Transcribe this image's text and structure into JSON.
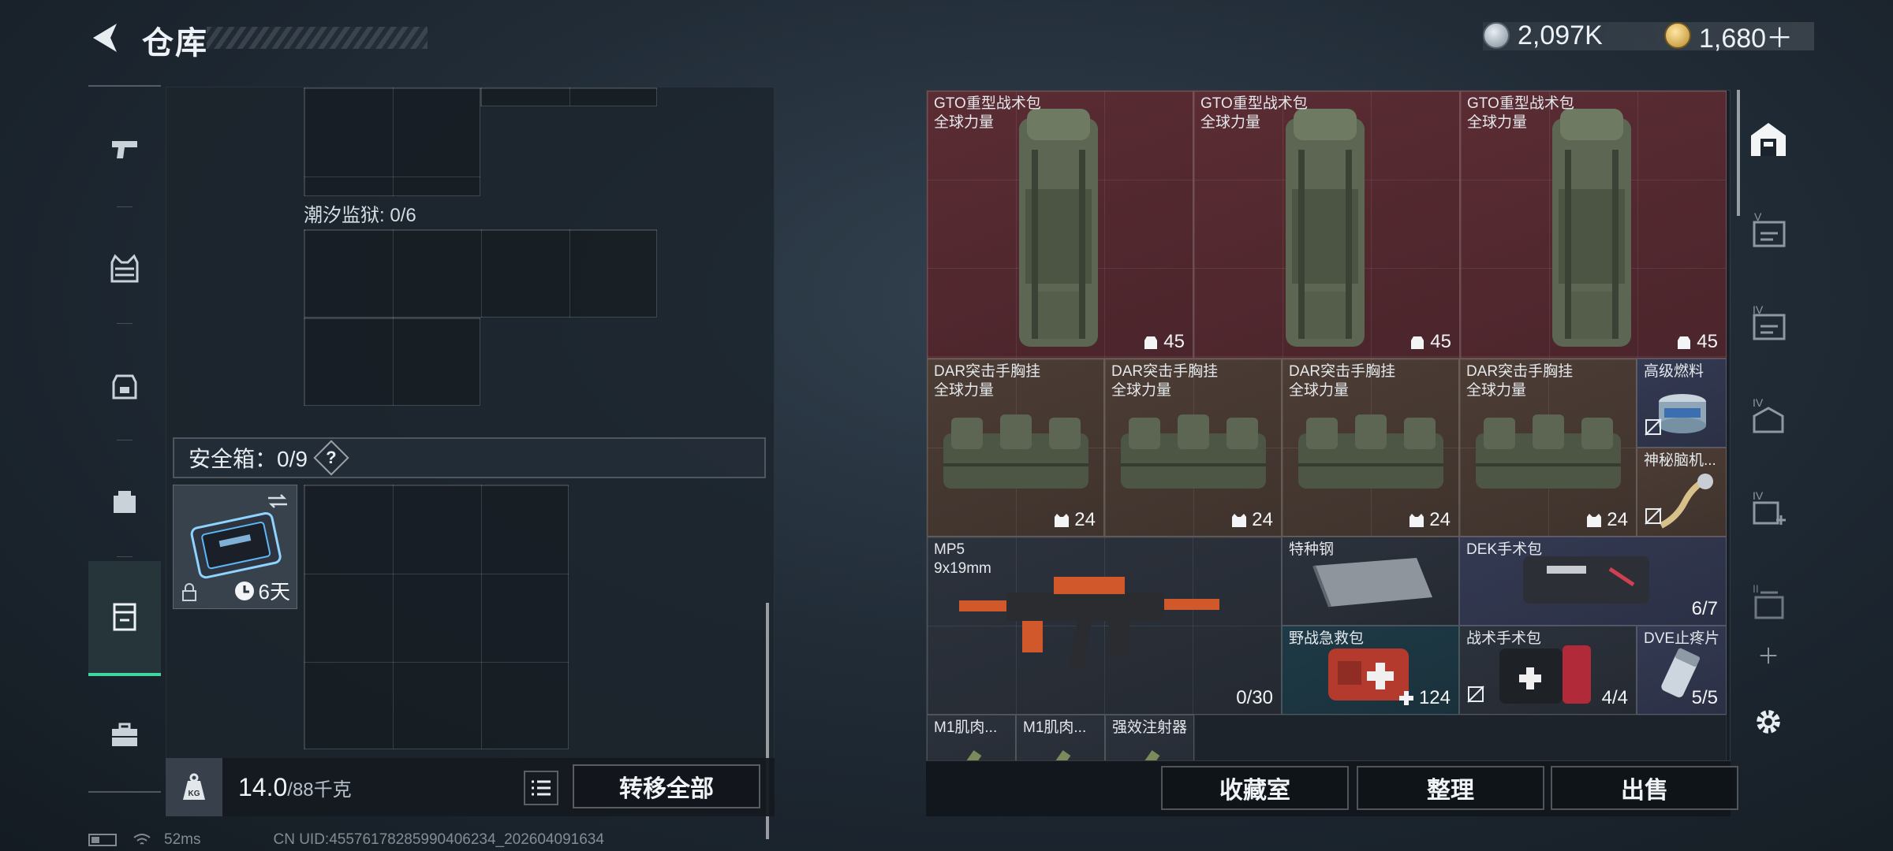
{
  "header": {
    "title": "仓库",
    "currencies": [
      {
        "icon": "silver-coin-icon",
        "value": "2,097K"
      },
      {
        "icon": "gold-coin-icon",
        "value": "1,680＋"
      }
    ]
  },
  "left_rail": {
    "items": [
      {
        "icon": "pistol-icon"
      },
      {
        "icon": "vest-icon"
      },
      {
        "icon": "backpack-icon"
      },
      {
        "icon": "pouch-icon"
      },
      {
        "icon": "safe-box-icon",
        "active": true
      },
      {
        "icon": "briefcase-icon"
      }
    ]
  },
  "storage": {
    "tide_prison_label": "潮汐监狱: 0/6",
    "safe_box_label": "安全箱：0/9",
    "help_label": "?",
    "safe_box_item": {
      "time": "6天",
      "icons": [
        "swap-icon",
        "lock-icon",
        "clock-icon"
      ]
    },
    "weight_value": "14.0",
    "weight_max": "/88千克",
    "kg_label": "KG",
    "transfer_all": "转移全部"
  },
  "inventory": {
    "items": [
      {
        "id": "gto1",
        "name": "GTO重型战术包",
        "sub": "全球力量",
        "count": "45",
        "count_icon": "backpack-icon"
      },
      {
        "id": "gto2",
        "name": "GTO重型战术包",
        "sub": "全球力量",
        "count": "45",
        "count_icon": "backpack-icon"
      },
      {
        "id": "gto3",
        "name": "GTO重型战术包",
        "sub": "全球力量",
        "count": "45",
        "count_icon": "backpack-icon"
      },
      {
        "id": "dar1",
        "name": "DAR突击手胸挂",
        "sub": "全球力量",
        "count": "24",
        "count_icon": "vest-icon"
      },
      {
        "id": "dar2",
        "name": "DAR突击手胸挂",
        "sub": "全球力量",
        "count": "24",
        "count_icon": "vest-icon"
      },
      {
        "id": "dar3",
        "name": "DAR突击手胸挂",
        "sub": "全球力量",
        "count": "24",
        "count_icon": "vest-icon"
      },
      {
        "id": "dar4",
        "name": "DAR突击手胸挂",
        "sub": "全球力量",
        "count": "24",
        "count_icon": "vest-icon"
      },
      {
        "id": "fuel",
        "name": "高级燃料",
        "sub": "",
        "count": "",
        "no_trade": true
      },
      {
        "id": "brain",
        "name": "神秘脑机...",
        "sub": "",
        "count": "",
        "no_trade": true
      },
      {
        "id": "mp5",
        "name": "MP5",
        "sub": "9x19mm",
        "count": "0/30"
      },
      {
        "id": "steel",
        "name": "特种钢",
        "sub": "",
        "count": ""
      },
      {
        "id": "dek",
        "name": "DEK手术包",
        "sub": "",
        "count": "6/7"
      },
      {
        "id": "medkit",
        "name": "野战急救包",
        "sub": "",
        "count": "124",
        "count_icon": "plus-icon"
      },
      {
        "id": "tactical",
        "name": "战术手术包",
        "sub": "",
        "count": "4/4",
        "no_trade": true
      },
      {
        "id": "dve",
        "name": "DVE止疼片",
        "sub": "",
        "count": "5/5"
      },
      {
        "id": "m1a",
        "name": "M1肌肉...",
        "sub": "",
        "count": ""
      },
      {
        "id": "m1b",
        "name": "M1肌肉...",
        "sub": "",
        "count": ""
      },
      {
        "id": "inj",
        "name": "强效注射器",
        "sub": "",
        "count": ""
      }
    ]
  },
  "actions": {
    "collection": "收藏室",
    "organize": "整理",
    "sell": "出售"
  },
  "right_rail": {
    "items": [
      {
        "icon": "warehouse-icon",
        "active": true
      },
      {
        "icon": "storage-v-icon",
        "label": "V"
      },
      {
        "icon": "storage-iv-icon",
        "label": "IV"
      },
      {
        "icon": "storage-iv-icon",
        "label": "IV"
      },
      {
        "icon": "storage-iv-icon",
        "label": "IV"
      },
      {
        "icon": "storage-ii-icon",
        "label": "II"
      },
      {
        "icon": "add-icon",
        "label": "+"
      },
      {
        "icon": "gear-icon"
      }
    ]
  },
  "status": {
    "ping": "52ms",
    "uid": "CN UID:455761782859904062​34_202604091634"
  }
}
